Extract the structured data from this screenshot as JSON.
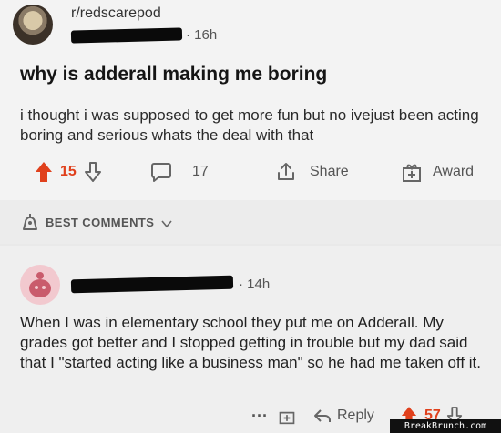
{
  "post": {
    "subreddit": "r/redscarepod",
    "time": "16h",
    "title": "why is adderall making me boring",
    "body": "i thought i was supposed to get more fun but no ivejust been acting boring and serious whats the deal with that",
    "upvotes": "15",
    "comments": "17",
    "share_label": "Share",
    "award_label": "Award",
    "upvote_color": "#e0401c"
  },
  "comments_section": {
    "label": "BEST COMMENTS"
  },
  "comment": {
    "time": "14h",
    "text": "When I was in elementary school they put me on Adderall. My grades got better and I stopped getting in trouble but my dad said that I \"started acting like a business man\" so he had me taken off it.",
    "more": "···",
    "reply_label": "Reply",
    "upvotes": "57"
  },
  "watermark": "BreakBrunch.com"
}
